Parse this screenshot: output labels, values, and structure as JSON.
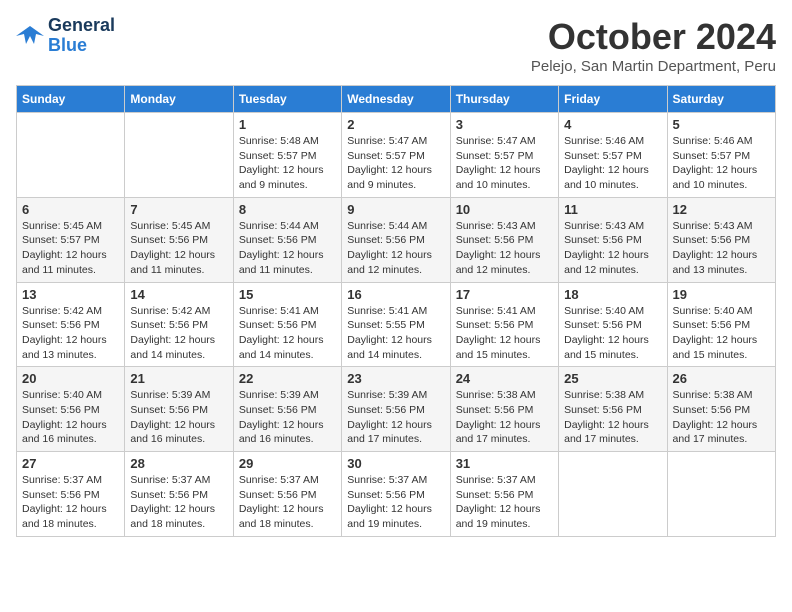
{
  "app": {
    "name": "GeneralBlue",
    "logo_text1": "General",
    "logo_text2": "Blue"
  },
  "header": {
    "month_year": "October 2024",
    "location": "Pelejo, San Martin Department, Peru"
  },
  "weekdays": [
    "Sunday",
    "Monday",
    "Tuesday",
    "Wednesday",
    "Thursday",
    "Friday",
    "Saturday"
  ],
  "weeks": [
    [
      {
        "day": "",
        "info": ""
      },
      {
        "day": "",
        "info": ""
      },
      {
        "day": "1",
        "info": "Sunrise: 5:48 AM\nSunset: 5:57 PM\nDaylight: 12 hours and 9 minutes."
      },
      {
        "day": "2",
        "info": "Sunrise: 5:47 AM\nSunset: 5:57 PM\nDaylight: 12 hours and 9 minutes."
      },
      {
        "day": "3",
        "info": "Sunrise: 5:47 AM\nSunset: 5:57 PM\nDaylight: 12 hours and 10 minutes."
      },
      {
        "day": "4",
        "info": "Sunrise: 5:46 AM\nSunset: 5:57 PM\nDaylight: 12 hours and 10 minutes."
      },
      {
        "day": "5",
        "info": "Sunrise: 5:46 AM\nSunset: 5:57 PM\nDaylight: 12 hours and 10 minutes."
      }
    ],
    [
      {
        "day": "6",
        "info": "Sunrise: 5:45 AM\nSunset: 5:57 PM\nDaylight: 12 hours and 11 minutes."
      },
      {
        "day": "7",
        "info": "Sunrise: 5:45 AM\nSunset: 5:56 PM\nDaylight: 12 hours and 11 minutes."
      },
      {
        "day": "8",
        "info": "Sunrise: 5:44 AM\nSunset: 5:56 PM\nDaylight: 12 hours and 11 minutes."
      },
      {
        "day": "9",
        "info": "Sunrise: 5:44 AM\nSunset: 5:56 PM\nDaylight: 12 hours and 12 minutes."
      },
      {
        "day": "10",
        "info": "Sunrise: 5:43 AM\nSunset: 5:56 PM\nDaylight: 12 hours and 12 minutes."
      },
      {
        "day": "11",
        "info": "Sunrise: 5:43 AM\nSunset: 5:56 PM\nDaylight: 12 hours and 12 minutes."
      },
      {
        "day": "12",
        "info": "Sunrise: 5:43 AM\nSunset: 5:56 PM\nDaylight: 12 hours and 13 minutes."
      }
    ],
    [
      {
        "day": "13",
        "info": "Sunrise: 5:42 AM\nSunset: 5:56 PM\nDaylight: 12 hours and 13 minutes."
      },
      {
        "day": "14",
        "info": "Sunrise: 5:42 AM\nSunset: 5:56 PM\nDaylight: 12 hours and 14 minutes."
      },
      {
        "day": "15",
        "info": "Sunrise: 5:41 AM\nSunset: 5:56 PM\nDaylight: 12 hours and 14 minutes."
      },
      {
        "day": "16",
        "info": "Sunrise: 5:41 AM\nSunset: 5:55 PM\nDaylight: 12 hours and 14 minutes."
      },
      {
        "day": "17",
        "info": "Sunrise: 5:41 AM\nSunset: 5:56 PM\nDaylight: 12 hours and 15 minutes."
      },
      {
        "day": "18",
        "info": "Sunrise: 5:40 AM\nSunset: 5:56 PM\nDaylight: 12 hours and 15 minutes."
      },
      {
        "day": "19",
        "info": "Sunrise: 5:40 AM\nSunset: 5:56 PM\nDaylight: 12 hours and 15 minutes."
      }
    ],
    [
      {
        "day": "20",
        "info": "Sunrise: 5:40 AM\nSunset: 5:56 PM\nDaylight: 12 hours and 16 minutes."
      },
      {
        "day": "21",
        "info": "Sunrise: 5:39 AM\nSunset: 5:56 PM\nDaylight: 12 hours and 16 minutes."
      },
      {
        "day": "22",
        "info": "Sunrise: 5:39 AM\nSunset: 5:56 PM\nDaylight: 12 hours and 16 minutes."
      },
      {
        "day": "23",
        "info": "Sunrise: 5:39 AM\nSunset: 5:56 PM\nDaylight: 12 hours and 17 minutes."
      },
      {
        "day": "24",
        "info": "Sunrise: 5:38 AM\nSunset: 5:56 PM\nDaylight: 12 hours and 17 minutes."
      },
      {
        "day": "25",
        "info": "Sunrise: 5:38 AM\nSunset: 5:56 PM\nDaylight: 12 hours and 17 minutes."
      },
      {
        "day": "26",
        "info": "Sunrise: 5:38 AM\nSunset: 5:56 PM\nDaylight: 12 hours and 17 minutes."
      }
    ],
    [
      {
        "day": "27",
        "info": "Sunrise: 5:37 AM\nSunset: 5:56 PM\nDaylight: 12 hours and 18 minutes."
      },
      {
        "day": "28",
        "info": "Sunrise: 5:37 AM\nSunset: 5:56 PM\nDaylight: 12 hours and 18 minutes."
      },
      {
        "day": "29",
        "info": "Sunrise: 5:37 AM\nSunset: 5:56 PM\nDaylight: 12 hours and 18 minutes."
      },
      {
        "day": "30",
        "info": "Sunrise: 5:37 AM\nSunset: 5:56 PM\nDaylight: 12 hours and 19 minutes."
      },
      {
        "day": "31",
        "info": "Sunrise: 5:37 AM\nSunset: 5:56 PM\nDaylight: 12 hours and 19 minutes."
      },
      {
        "day": "",
        "info": ""
      },
      {
        "day": "",
        "info": ""
      }
    ]
  ]
}
